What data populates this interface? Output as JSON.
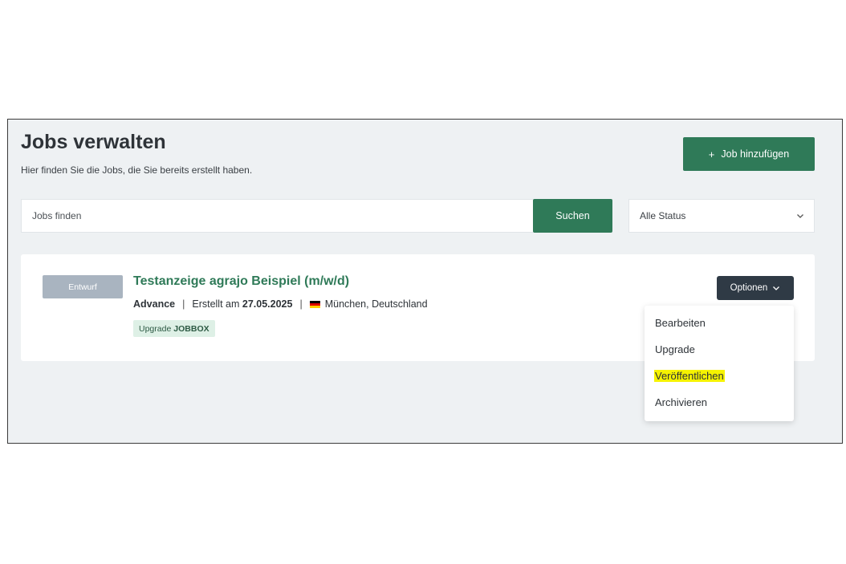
{
  "header": {
    "title": "Jobs verwalten",
    "subtitle": "Hier finden Sie die Jobs, die Sie bereits erstellt haben.",
    "add_button_icon": "+",
    "add_button_label": "Job hinzufügen"
  },
  "search": {
    "placeholder": "Jobs finden",
    "button_label": "Suchen"
  },
  "status_filter": {
    "selected": "Alle Status",
    "icon": "chevron-down-icon"
  },
  "job": {
    "status_badge": "Entwurf",
    "title": "Testanzeige agrajo Beispiel (m/w/d)",
    "package": "Advance",
    "separator": "|",
    "created_label": "Erstellt am",
    "created_date": "27.05.2025",
    "location": "München, Deutschland",
    "flag_colors": [
      "#000000",
      "#dd0000",
      "#ffce00"
    ],
    "upgrade_prefix": "Upgrade",
    "upgrade_product": "JOBBOX",
    "options_label": "Optionen"
  },
  "options_menu": {
    "items": [
      "Bearbeiten",
      "Upgrade",
      "Veröffentlichen",
      "Archivieren"
    ],
    "highlighted_item": "Veröffentlichen",
    "highlight_color": "#f6f300"
  },
  "colors": {
    "primary_green": "#2f7a58",
    "dark_button": "#2f3a45",
    "draft_badge": "#a9b4c0",
    "page_background": "#eef1f3"
  }
}
